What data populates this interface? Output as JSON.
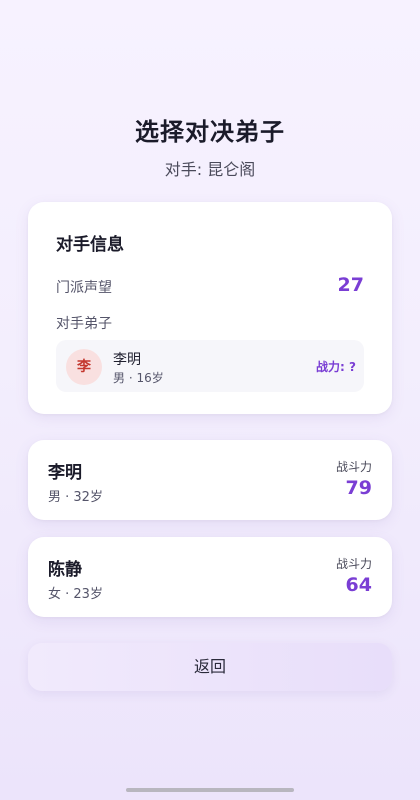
{
  "header": {
    "title": "选择对决弟子",
    "subtitle": "对手: 昆仑阁"
  },
  "opponent": {
    "title": "对手信息",
    "prestige_label": "门派声望",
    "prestige_value": "27",
    "disciples_label": "对手弟子",
    "disciple": {
      "avatar_char": "李",
      "name": "李明",
      "meta": "男 · 16岁",
      "power": "战力: ?"
    }
  },
  "disciples": [
    {
      "name": "李明",
      "meta": "男 · 32岁",
      "power_label": "战斗力",
      "power": "79"
    },
    {
      "name": "陈静",
      "meta": "女 · 23岁",
      "power_label": "战斗力",
      "power": "64"
    }
  ],
  "footer": {
    "back_label": "返回"
  },
  "colors": {
    "accent": "#7a3ed4",
    "avatar_bg": "#f9e0e0",
    "avatar_text": "#c4382f"
  }
}
